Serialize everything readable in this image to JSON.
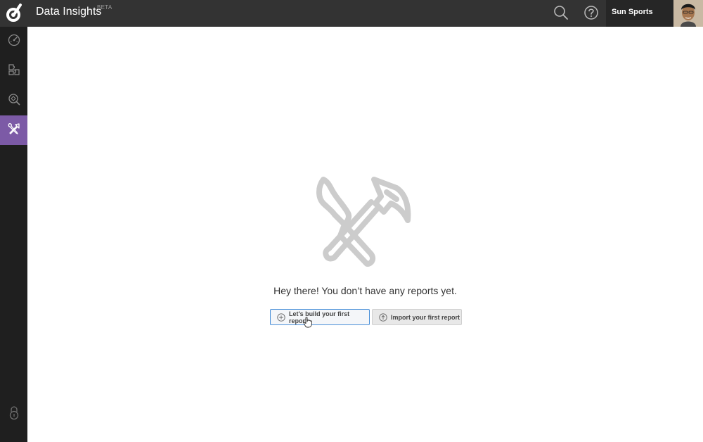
{
  "header": {
    "app_title": "Data Insights",
    "beta_badge": "BETA",
    "org_name": "Sun Sports",
    "icons": [
      "logo-icon",
      "search-icon",
      "help-icon"
    ]
  },
  "sidebar": {
    "items": [
      {
        "name": "dashboard-icon",
        "active": false
      },
      {
        "name": "puzzle-icon",
        "active": false
      },
      {
        "name": "explore-icon",
        "active": false
      },
      {
        "name": "tools-icon",
        "active": true
      }
    ],
    "bottom_icon": "lock-icon"
  },
  "main": {
    "empty_message": "Hey there! You don’t have any reports yet.",
    "build_button": "Let's build your first report",
    "import_button": "Import your first report"
  },
  "colors": {
    "topbar": "#333333",
    "sidebar": "#1f1f1f",
    "active_nav": "#7c5aa6",
    "primary_border": "#4a90d9",
    "illustration": "#cccccc"
  }
}
